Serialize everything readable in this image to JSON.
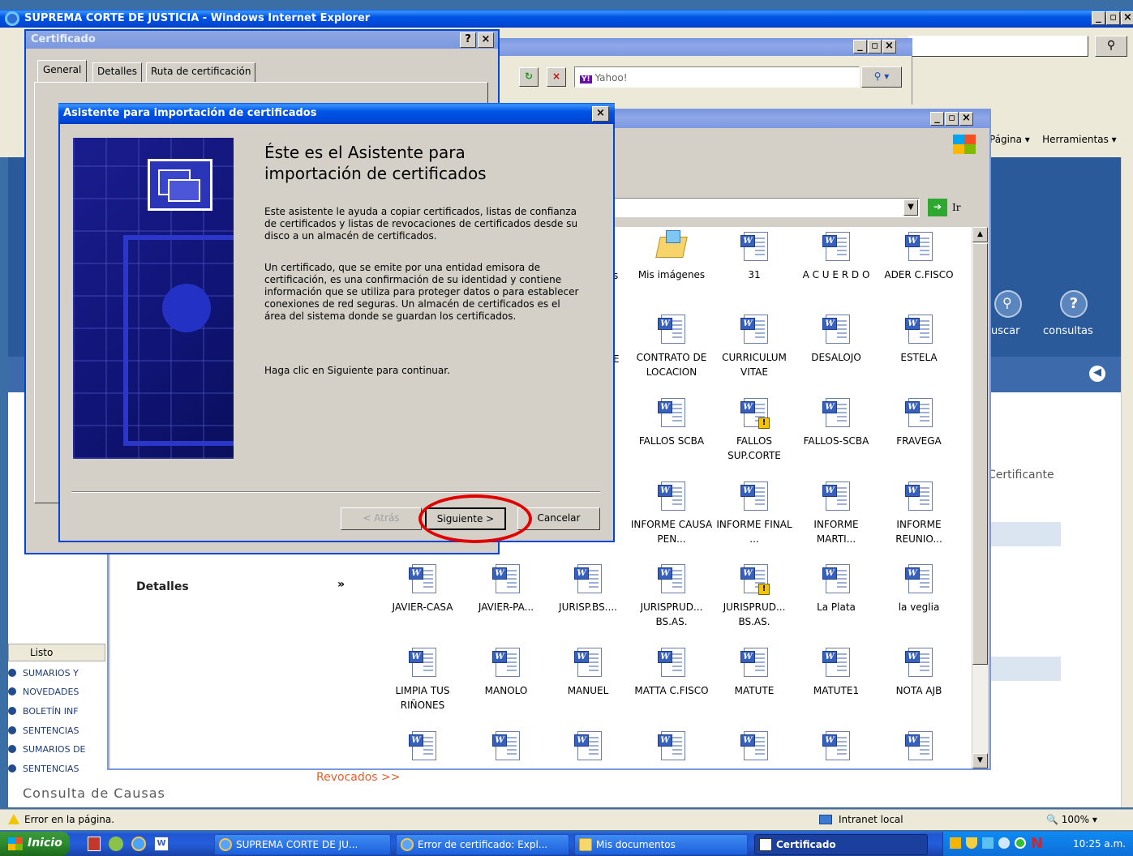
{
  "ie_window": {
    "title": "SUPREMA CORTE DE JUSTICIA - Windows Internet Explorer",
    "status_text": "Listo",
    "page_links": {
      "pagina": "Página",
      "herramientas": "Herramientas"
    },
    "nav_icons": {
      "buscar": "uscar",
      "consultas": "consultas"
    },
    "certificante": "Certificante",
    "revocados": "Revocados >>",
    "consulta_causas": "Consulta de Causas",
    "sidebar_items": [
      "SUMARIOS Y",
      "NOVEDADES",
      "BOLETÍN INF",
      "SENTENCIAS",
      "SUMARIOS DE",
      "SENTENCIAS"
    ],
    "status_error": "Error en la página.",
    "zone": "Intranet local",
    "zoom": "100%"
  },
  "browser2": {
    "search_placeholder": "Yahoo!"
  },
  "certificate_dialog": {
    "title": "Certificado",
    "tabs": [
      "General",
      "Detalles",
      "Ruta de certificación"
    ],
    "help_btn": "?",
    "close_btn": "×"
  },
  "wizard": {
    "title": "Asistente para importación de certificados",
    "heading": "Éste es el Asistente para importación de certificados",
    "para1": "Este asistente le ayuda a copiar certificados, listas de confianza de certificados y listas de revocaciones de certificados desde su disco a un almacén de certificados.",
    "para2": "Un certificado, que se emite por una entidad emisora de certificación, es una confirmación de su identidad y contiene información que se utiliza para proteger datos o para establecer conexiones de red seguras. Un almacén de certificados es el área del sistema donde se guardan los certificados.",
    "para3": "Haga clic en Siguiente para continuar.",
    "back_btn": "< Atrás",
    "next_btn": "Siguiente >",
    "cancel_btn": "Cancelar"
  },
  "explorer": {
    "go_label": "Ir",
    "details_label": "Detalles",
    "partial_letters": {
      "s": "s",
      "e": "E"
    },
    "files": [
      {
        "name": "Mis imágenes",
        "icon": "folder-pictures-icon"
      },
      {
        "name": "31",
        "icon": "word-doc-icon"
      },
      {
        "name": "A C U E R D O",
        "icon": "word-doc-icon"
      },
      {
        "name": "ADER C.FISCO",
        "icon": "word-doc-icon"
      },
      {
        "name": "CONTRATO DE LOCACION",
        "icon": "word-doc-icon"
      },
      {
        "name": "CURRICULUM VITAE",
        "icon": "word-doc-icon"
      },
      {
        "name": "DESALOJO",
        "icon": "word-doc-icon"
      },
      {
        "name": "ESTELA",
        "icon": "word-doc-icon"
      },
      {
        "name": "FALLOS SCBA",
        "icon": "word-doc-icon"
      },
      {
        "name": "FALLOS SUP.CORTE",
        "icon": "word-doc-warning-icon"
      },
      {
        "name": "FALLOS-SCBA",
        "icon": "word-doc-icon"
      },
      {
        "name": "FRAVEGA",
        "icon": "word-doc-icon"
      },
      {
        "name": "INFORME CAUSA PEN...",
        "icon": "word-doc-icon"
      },
      {
        "name": "INFORME FINAL ...",
        "icon": "word-doc-icon"
      },
      {
        "name": "INFORME MARTI...",
        "icon": "word-doc-icon"
      },
      {
        "name": "INFORME REUNIO...",
        "icon": "word-doc-icon"
      },
      {
        "name": "JAVIER-CASA",
        "icon": "word-doc-icon"
      },
      {
        "name": "JAVIER-PA...",
        "icon": "word-doc-icon"
      },
      {
        "name": "JURISP.BS....",
        "icon": "word-doc-icon"
      },
      {
        "name": "JURISPRUD... BS.AS.",
        "icon": "word-doc-icon"
      },
      {
        "name": "JURISPRUD... BS.AS.",
        "icon": "word-doc-warning-icon"
      },
      {
        "name": "La Plata",
        "icon": "word-doc-icon"
      },
      {
        "name": "la veglia",
        "icon": "word-doc-icon"
      },
      {
        "name": "LIMPIA TUS RIÑONES",
        "icon": "word-doc-icon"
      },
      {
        "name": "MANOLO",
        "icon": "word-doc-icon"
      },
      {
        "name": "MANUEL",
        "icon": "word-doc-icon"
      },
      {
        "name": "MATTA C.FISCO",
        "icon": "word-doc-icon"
      },
      {
        "name": "MATUTE",
        "icon": "word-doc-icon"
      },
      {
        "name": "MATUTE1",
        "icon": "word-doc-icon"
      },
      {
        "name": "NOTA AJB",
        "icon": "word-doc-icon"
      }
    ]
  },
  "taskbar": {
    "start": "Inicio",
    "buttons": [
      "SUPREMA CORTE DE JU...",
      "Error de certificado: Expl...",
      "Mis documentos",
      "Certificado"
    ],
    "clock": "10:25 a.m."
  },
  "colors": {
    "highlight_circle": "#e00000",
    "xp_blue": "#0054e3",
    "dialog_face": "#d4d0c8"
  }
}
